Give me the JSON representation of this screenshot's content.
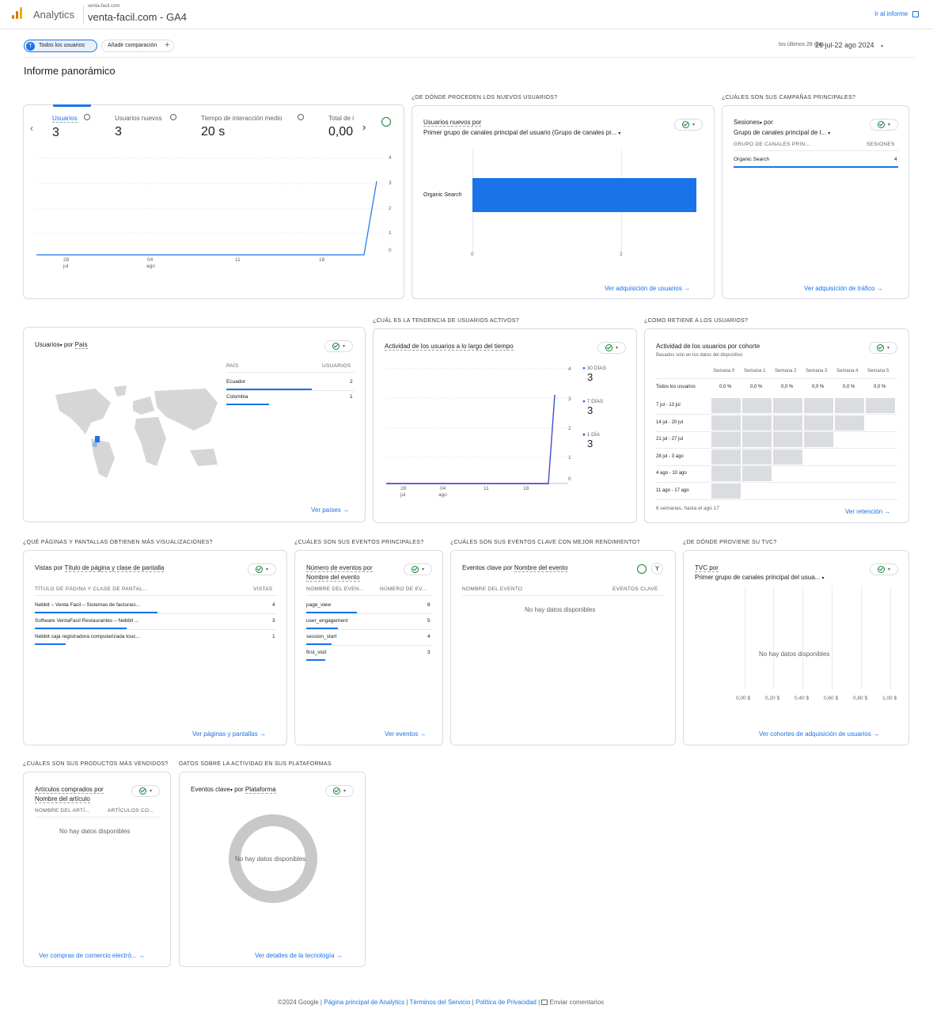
{
  "header": {
    "app": "Analytics",
    "account": "venta-facil.com",
    "property": "venta-facil.com - GA4",
    "report_link": "Ir al informe"
  },
  "toolbar": {
    "segment": "Todos los usuarios",
    "segment_initial": "T",
    "compare": "Añadir comparación",
    "date_label": "los últimos 28 días",
    "date_range": "26 jul-22 ago 2024"
  },
  "page_title": "Informe panorámico",
  "sections": {
    "new_users": "¿DE DÓNDE PROCEDEN LOS NUEVOS USUARIOS?",
    "campaigns": "¿CUÁLES SON SUS CAMPAÑAS PRINCIPALES?",
    "active_trend": "¿CUÁL ES LA TENDENCIA DE USUARIOS ACTIVOS?",
    "retention": "¿CÓMO RETIENE A LOS USUARIOS?",
    "pages": "¿QUÉ PÁGINAS Y PANTALLAS OBTIENEN MÁS VISUALIZACIONES?",
    "events": "¿CUÁLES SON SUS EVENTOS PRINCIPALES?",
    "key_events": "¿CUÁLES SON SUS EVENTOS CLAVE CON MEJOR RENDIMIENTO?",
    "ltv": "¿DE DÓNDE PROVIENE SU TVC?",
    "products": "¿CUÁLES SON SUS PRODUCTOS MÁS VENDIDOS?",
    "platforms": "DATOS SOBRE LA ACTIVIDAD EN SUS PLATAFORMAS"
  },
  "metrics": [
    {
      "label": "Usuarios",
      "value": "3"
    },
    {
      "label": "Usuarios nuevos",
      "value": "3"
    },
    {
      "label": "Tiempo de interacción medio",
      "value": "20 s"
    },
    {
      "label": "Total de i",
      "value": "0,00"
    }
  ],
  "overview_chart": {
    "y_ticks": [
      "4",
      "3",
      "2",
      "1",
      "0"
    ],
    "x_ticks": [
      "28",
      "04",
      "11",
      "18"
    ],
    "x_sub": [
      "jul",
      "ago"
    ]
  },
  "new_users_card": {
    "metric": "Usuarios nuevos por",
    "dimension": "Primer grupo de canales principal del usuario (Grupo de canales pr...",
    "bar_label": "Organic Search",
    "x_ticks": [
      "0",
      "2"
    ],
    "link": "Ver adquisición de usuarios"
  },
  "campaigns_card": {
    "metric": "Sesiones",
    "by": "por",
    "dimension": "Grupo de canales principal de l...",
    "col1": "GRUPO DE CANALES PRIN...",
    "col2": "SESIONES",
    "row_label": "Organic Search",
    "row_value": "4",
    "link": "Ver adquisición de tráfico"
  },
  "country_card": {
    "metric": "Usuarios",
    "by": "por",
    "dimension": "País",
    "col1": "PAÍS",
    "col2": "USUARIOS",
    "rows": [
      {
        "name": "Ecuador",
        "value": "2"
      },
      {
        "name": "Colombia",
        "value": "1"
      }
    ],
    "link": "Ver países"
  },
  "active_card": {
    "title": "Actividad de los usuarios a lo largo del tiempo",
    "y_ticks": [
      "4",
      "3",
      "2",
      "1",
      "0"
    ],
    "x_ticks": [
      "28",
      "04",
      "11",
      "18"
    ],
    "x_sub": [
      "jul",
      "ago"
    ],
    "legend": [
      {
        "label": "30 DÍAS",
        "value": "3"
      },
      {
        "label": "7 DÍAS",
        "value": "3"
      },
      {
        "label": "1 DÍA",
        "value": "3"
      }
    ]
  },
  "retention_card": {
    "title": "Actividad de los usuarios por cohorte",
    "subtitle": "Basados solo en los datos del dispositivo",
    "weeks": [
      "Semana 0",
      "Semana 1",
      "Semana 2",
      "Semana 3",
      "Semana 4",
      "Semana 5"
    ],
    "all_label": "Todos los usuarios",
    "all_values": [
      "0,0 %",
      "0,0 %",
      "0,0 %",
      "0,0 %",
      "0,0 %",
      "0,0 %"
    ],
    "rows": [
      "7 jul - 13 jul",
      "14 jul - 20 jul",
      "21 jul - 27 jul",
      "28 jul - 3 ago",
      "4 ago - 10 ago",
      "11 ago - 17 ago"
    ],
    "footer": "6 semanas, hasta el ago 17",
    "link": "Ver retención"
  },
  "pages_card": {
    "metric": "Vistas por",
    "dimension": "Título de página y clase de pantalla",
    "col1": "TÍTULO DE PÁGINA Y CLASE DE PANTAL...",
    "col2": "VISTAS",
    "rows": [
      {
        "name": "Nebbit – Venta Facil – Sistemas de facturaci...",
        "value": "4"
      },
      {
        "name": "Software VentaFacil Restaurantes – Nebbit ...",
        "value": "3"
      },
      {
        "name": "Nebbit caja registradora computarizada touc...",
        "value": "1"
      }
    ],
    "link": "Ver páginas y pantallas"
  },
  "events_card": {
    "metric": "Número de eventos por",
    "dimension": "Nombre del evento",
    "col1": "NOMBRE DEL EVEN...",
    "col2": "NÚMERO DE EV...",
    "rows": [
      {
        "name": "page_view",
        "value": "8"
      },
      {
        "name": "user_engagement",
        "value": "5"
      },
      {
        "name": "session_start",
        "value": "4"
      },
      {
        "name": "first_visit",
        "value": "3"
      }
    ],
    "link": "Ver eventos"
  },
  "key_events_card": {
    "metric": "Eventos clave por",
    "dimension": "Nombre del evento",
    "col1": "NOMBRE DEL EVENTO",
    "col2": "EVENTOS CLAVE",
    "nodata": "No hay datos disponibles"
  },
  "ltv_card": {
    "metric": "TVC por",
    "dimension": "Primer grupo de canales principal del usua...",
    "nodata": "No hay datos disponibles",
    "x_ticks": [
      "0,00 $",
      "0,20 $",
      "0,40 $",
      "0,60 $",
      "0,80 $",
      "1,00 $"
    ],
    "link": "Ver cohortes de adquisición de usuarios"
  },
  "products_card": {
    "metric": "Artículos comprados por",
    "dimension": "Nombre del artículo",
    "col1": "NOMBRE DEL ARTÍ...",
    "col2": "ARTÍCULOS CO...",
    "nodata": "No hay datos disponibles",
    "link": "Ver compras de comercio electró..."
  },
  "platform_card": {
    "metric": "Eventos clave",
    "by": "por",
    "dimension": "Plataforma",
    "nodata": "No hay datos disponibles",
    "link": "Ver detalles de la tecnología"
  },
  "footer": {
    "copyright": "©2024 Google |",
    "home": "Página principal de Analytics",
    "terms": "Términos del Servicio",
    "privacy": "Política de Privacidad",
    "feedback": "Enviar comentarios",
    "sep": "|"
  },
  "colors": {
    "accent": "#1a73e8",
    "series_purple": "#7b1fa2",
    "check_green": "#188038"
  }
}
